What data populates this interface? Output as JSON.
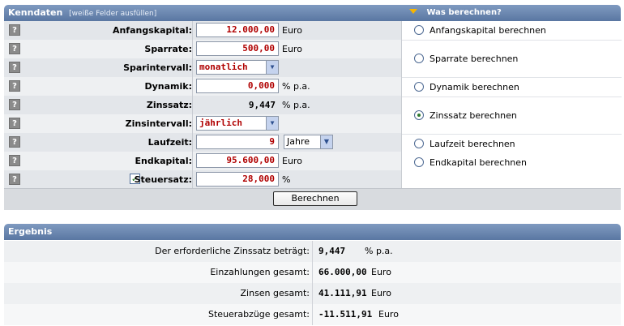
{
  "kenndaten": {
    "title": "Kenndaten",
    "hint": "[weiße Felder ausfüllen]",
    "right_title": "Was berechnen?",
    "help_label": "?",
    "rows": {
      "anfangskapital": {
        "label": "Anfangskapital:",
        "value": "12.000,00",
        "unit": "Euro"
      },
      "sparrate": {
        "label": "Sparrate:",
        "value": "500,00",
        "unit": "Euro"
      },
      "sparintervall": {
        "label": "Sparintervall:",
        "value": "monatlich"
      },
      "dynamik": {
        "label": "Dynamik:",
        "value": "0,000",
        "unit": "% p.a."
      },
      "zinssatz": {
        "label": "Zinssatz:",
        "value": "9,447",
        "unit": "% p.a."
      },
      "zinsintervall": {
        "label": "Zinsintervall:",
        "value": "jährlich"
      },
      "laufzeit": {
        "label": "Laufzeit:",
        "value": "9",
        "unit_select": "Jahre"
      },
      "endkapital": {
        "label": "Endkapital:",
        "value": "95.600,00",
        "unit": "Euro"
      },
      "steuersatz": {
        "label": "Steuersatz:",
        "value": "28,000",
        "unit": "%",
        "checked": true
      }
    },
    "options": [
      {
        "label": "Anfangskapital berechnen",
        "selected": false
      },
      {
        "label": "Sparrate berechnen",
        "selected": false
      },
      {
        "label": "Dynamik berechnen",
        "selected": false
      },
      {
        "label": "Zinssatz berechnen",
        "selected": true
      },
      {
        "label": "Laufzeit berechnen",
        "selected": false
      },
      {
        "label": "Endkapital berechnen",
        "selected": false
      }
    ],
    "button_label": "Berechnen"
  },
  "ergebnis": {
    "title": "Ergebnis",
    "rows": [
      {
        "label": "Der erforderliche Zinssatz beträgt:",
        "value": "9,447",
        "unit": "% p.a."
      },
      {
        "label": "Einzahlungen gesamt:",
        "value": "66.000,00",
        "unit": "Euro"
      },
      {
        "label": "Zinsen gesamt:",
        "value": "41.111,91",
        "unit": "Euro"
      },
      {
        "label": "Steuerabzüge gesamt:",
        "value": "-11.511,91",
        "unit": "Euro"
      }
    ]
  },
  "colors": {
    "header": "#5a77a2",
    "input_text": "#b00000",
    "accent_triangle": "#f7b500",
    "radio_selected": "#2e7a2e"
  }
}
